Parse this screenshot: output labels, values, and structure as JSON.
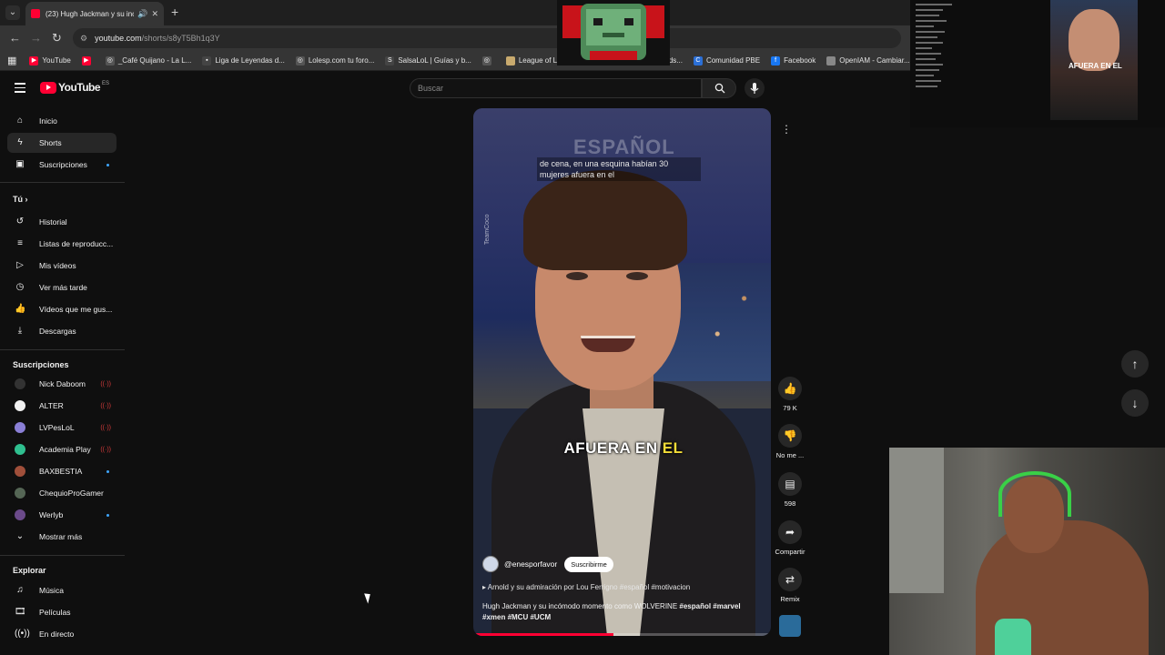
{
  "browser": {
    "tab_title": "(23) Hugh Jackman y su inc",
    "url_host": "youtube.com",
    "url_path": "/shorts/s8yT5Bh1q3Y",
    "bookmarks": [
      {
        "label": "YouTube",
        "icon": "youtube-icon",
        "color": "#ff0033"
      },
      {
        "label": "",
        "icon": "youtube-icon",
        "color": "#ff0033"
      },
      {
        "label": "_Café Quijano - La L...",
        "icon": "globe-icon",
        "color": "#555555"
      },
      {
        "label": "Liga de Leyendas d...",
        "icon": "site-icon",
        "color": "#444444"
      },
      {
        "label": "Lolesp.com tu foro...",
        "icon": "globe-icon",
        "color": "#555555"
      },
      {
        "label": "SalsaLoL | Guías y b...",
        "icon": "site-icon",
        "color": "#444444"
      },
      {
        "label": "",
        "icon": "globe-icon",
        "color": "#555555"
      },
      {
        "label": "League of Legends",
        "icon": "lol-icon",
        "color": "#c8aa6e"
      },
      {
        "label": "...egends...",
        "icon": "site-icon",
        "color": "#444444"
      },
      {
        "label": "Comunidad PBE",
        "icon": "site-icon",
        "color": "#2b6fd6"
      },
      {
        "label": "Facebook",
        "icon": "facebook-icon",
        "color": "#1877f2"
      },
      {
        "label": "OpenIAM - Cambiar...",
        "icon": "site-icon",
        "color": "#888888"
      }
    ]
  },
  "youtube": {
    "logo_text": "YouTube",
    "country_code": "ES",
    "search_placeholder": "Buscar",
    "sidebar": {
      "main": [
        {
          "label": "Inicio",
          "icon": "home-icon"
        },
        {
          "label": "Shorts",
          "icon": "shorts-icon",
          "active": true
        },
        {
          "label": "Suscripciones",
          "icon": "subscriptions-icon"
        }
      ],
      "you_heading": "Tú",
      "you_items": [
        {
          "label": "Historial",
          "icon": "history-icon"
        },
        {
          "label": "Listas de reproducc...",
          "icon": "playlists-icon"
        },
        {
          "label": "Mis vídeos",
          "icon": "my-videos-icon"
        },
        {
          "label": "Ver más tarde",
          "icon": "watch-later-icon"
        },
        {
          "label": "Vídeos que me gus...",
          "icon": "liked-icon"
        },
        {
          "label": "Descargas",
          "icon": "download-icon"
        }
      ],
      "subs_heading": "Suscripciones",
      "subs": [
        {
          "label": "Nick Daboom",
          "color": "#333333",
          "status": "live"
        },
        {
          "label": "ALTER",
          "color": "#f1f1f1",
          "status": "live"
        },
        {
          "label": "LVPesLoL",
          "color": "#8a7fd6",
          "status": "live"
        },
        {
          "label": "Academia Play",
          "color": "#2fbf8f",
          "status": "live"
        },
        {
          "label": "BAXBESTIA",
          "color": "#a04f3a",
          "status": "new"
        },
        {
          "label": "ChequioProGamer",
          "color": "#556655",
          "status": ""
        },
        {
          "label": "Werlyb",
          "color": "#6b4a8a",
          "status": "new"
        }
      ],
      "show_more": "Mostrar más",
      "explore_heading": "Explorar",
      "explore": [
        {
          "label": "Música",
          "icon": "music-icon"
        },
        {
          "label": "Películas",
          "icon": "movies-icon"
        },
        {
          "label": "En directo",
          "icon": "live-icon"
        }
      ]
    },
    "short": {
      "watermark": "ESPAÑOL",
      "subtitle": "de cena, en una esquina habían 30 mujeres afuera en el",
      "caption_main": "AFUERA EN",
      "caption_highlight": "EL",
      "side_tag": "TeamCoco",
      "channel": "@enesporfavor",
      "subscribe": "Suscribirme",
      "related": "Arnold y su admiración por Lou Ferrigno #español  #motivacion",
      "description_text": "Hugh Jackman y su incómodo momento como WOLVERINE",
      "description_tags": "#español #marvel #xmen #MCU #UCM",
      "progress": 0.47
    },
    "actions": {
      "like_count": "79 K",
      "dislike_label": "No me ...",
      "comments_count": "598",
      "share_label": "Compartir",
      "remix_label": "Remix"
    }
  },
  "overlay": {
    "mini_caption": "AFUERA EN EL"
  }
}
